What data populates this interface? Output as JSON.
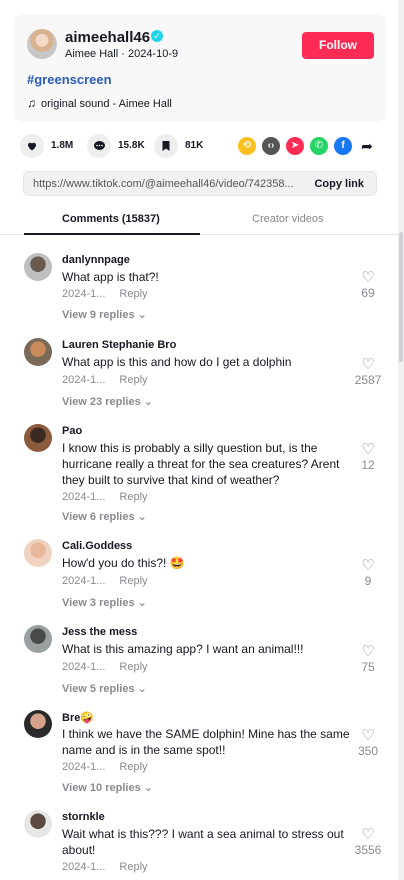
{
  "post": {
    "username": "aimeehall46",
    "display_name": "Aimee Hall",
    "date": "2024-10-9",
    "subline": "Aimee Hall · 2024-10-9",
    "follow_label": "Follow",
    "hashtag": "#greenscreen",
    "sound": "original sound - Aimee Hall"
  },
  "actions": {
    "likes": "1.8M",
    "comments": "15.8K",
    "saves": "81K"
  },
  "share_icons": [
    "repost-icon",
    "embed-icon",
    "send-icon",
    "whatsapp-icon",
    "facebook-icon",
    "share-arrow-icon"
  ],
  "link": {
    "url": "https://www.tiktok.com/@aimeehall46/video/742358...",
    "copy_label": "Copy link"
  },
  "tabs": {
    "comments": "Comments (15837)",
    "creator": "Creator videos"
  },
  "comments": [
    {
      "user": "danlynnpage",
      "text": "What app is that?!",
      "date": "2024-1...",
      "reply": "Reply",
      "replies": "View 9 replies ⌄",
      "likes": "69"
    },
    {
      "user": "Lauren Stephanie Bro",
      "text": "What app is this and how do I get a dolphin",
      "date": "2024-1...",
      "reply": "Reply",
      "replies": "View 23 replies ⌄",
      "likes": "2587"
    },
    {
      "user": "Pao",
      "text": "I know this is probably a silly question but, is the hurricane really a threat for the sea creatures? Arent they built to survive that kind of weather?",
      "date": "2024-1...",
      "reply": "Reply",
      "replies": "View 6 replies ⌄",
      "likes": "12"
    },
    {
      "user": "Cali.Goddess",
      "text": "How'd you do this?! 🤩",
      "date": "2024-1...",
      "reply": "Reply",
      "replies": "View 3 replies ⌄",
      "likes": "9"
    },
    {
      "user": "Jess the mess",
      "text": "What is this amazing app? I want an animal!!!",
      "date": "2024-1...",
      "reply": "Reply",
      "replies": "View 5 replies ⌄",
      "likes": "75"
    },
    {
      "user": "Bre🤪",
      "text": "I think we have the SAME dolphin! Mine has the same name and is in the same spot!!",
      "date": "2024-1...",
      "reply": "Reply",
      "replies": "View 10 replies ⌄",
      "likes": "350"
    },
    {
      "user": "stornkle",
      "text": "Wait what is this??? I want a sea animal to stress out about!",
      "date": "2024-1...",
      "reply": "Reply",
      "replies": "",
      "likes": "3556"
    }
  ]
}
